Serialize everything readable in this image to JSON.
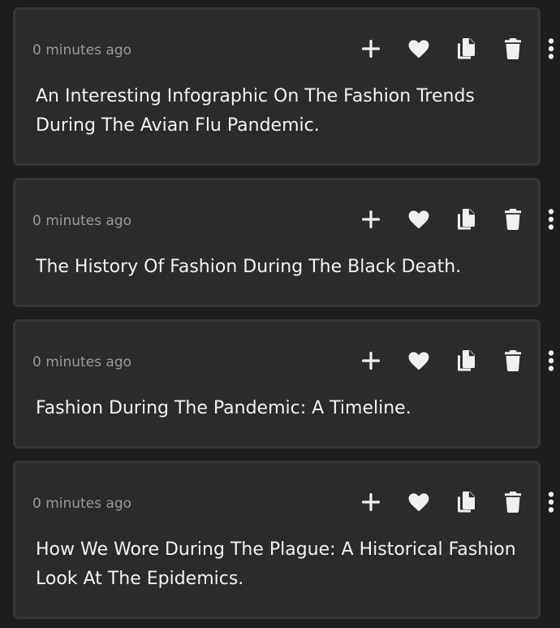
{
  "cards": [
    {
      "timestamp": "0 minutes ago",
      "title": "An Interesting Infographic On The Fashion Trends During The Avian Flu Pandemic."
    },
    {
      "timestamp": "0 minutes ago",
      "title": "The History Of Fashion During The Black Death."
    },
    {
      "timestamp": "0 minutes ago",
      "title": "Fashion During The Pandemic: A Timeline."
    },
    {
      "timestamp": "0 minutes ago",
      "title": "How We Wore During The Plague: A Historical Fashion Look At The Epidemics."
    }
  ],
  "icons": {
    "add": "plus-icon",
    "like": "heart-icon",
    "copy": "copy-icon",
    "delete": "trash-icon",
    "more": "more-vertical-icon"
  },
  "colors": {
    "page_background": "#1d1d1d",
    "card_background": "#2b2b2b",
    "card_border": "#363636",
    "timestamp_text": "#9a9a9a",
    "title_text": "#f2f2f2",
    "icon": "#f0f0f0"
  }
}
